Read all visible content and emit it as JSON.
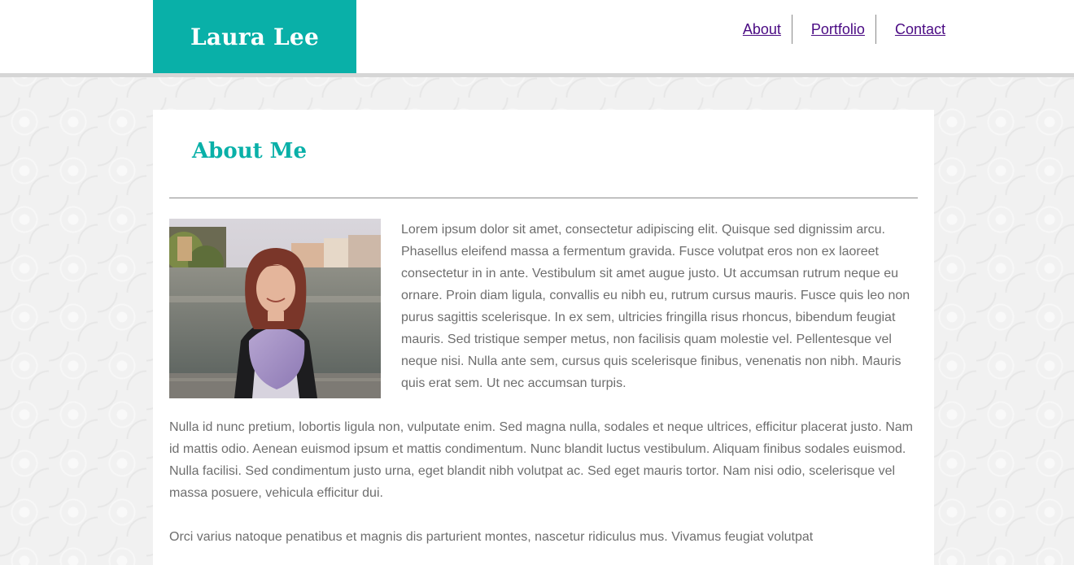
{
  "site": {
    "logo": "Laura Lee"
  },
  "nav": {
    "items": [
      "About",
      "Portfolio",
      "Contact"
    ]
  },
  "main": {
    "title": "About Me",
    "photo_icon": "portrait-photo",
    "paragraphs": [
      "Lorem ipsum dolor sit amet, consectetur adipiscing elit. Quisque sed dignissim arcu. Phasellus eleifend massa a fermentum gravida. Fusce volutpat eros non ex laoreet consectetur in in ante. Vestibulum sit amet augue justo. Ut accumsan rutrum neque eu ornare. Proin diam ligula, convallis eu nibh eu, rutrum cursus mauris. Fusce quis leo non purus sagittis scelerisque. In ex sem, ultricies fringilla risus rhoncus, bibendum feugiat mauris. Sed tristique semper metus, non facilisis quam molestie vel. Pellentesque vel neque nisi. Nulla ante sem, cursus quis scelerisque finibus, venenatis non nibh. Mauris quis erat sem. Ut nec accumsan turpis.",
      "Nulla id nunc pretium, lobortis ligula non, vulputate enim. Sed magna nulla, sodales et neque ultrices, efficitur placerat justo. Nam id mattis odio. Aenean euismod ipsum et mattis condimentum. Nunc blandit luctus vestibulum. Aliquam finibus sodales euismod. Nulla facilisi. Sed condimentum justo urna, eget blandit nibh volutpat ac. Sed eget mauris tortor. Nam nisi odio, scelerisque vel massa posuere, vehicula efficitur dui.",
      "Orci varius natoque penatibus et magnis dis parturient montes, nascetur ridiculus mus. Vivamus feugiat volutpat"
    ]
  },
  "colors": {
    "accent": "#09b0a8",
    "link": "#4a0a83",
    "text": "#6e6e6e"
  }
}
